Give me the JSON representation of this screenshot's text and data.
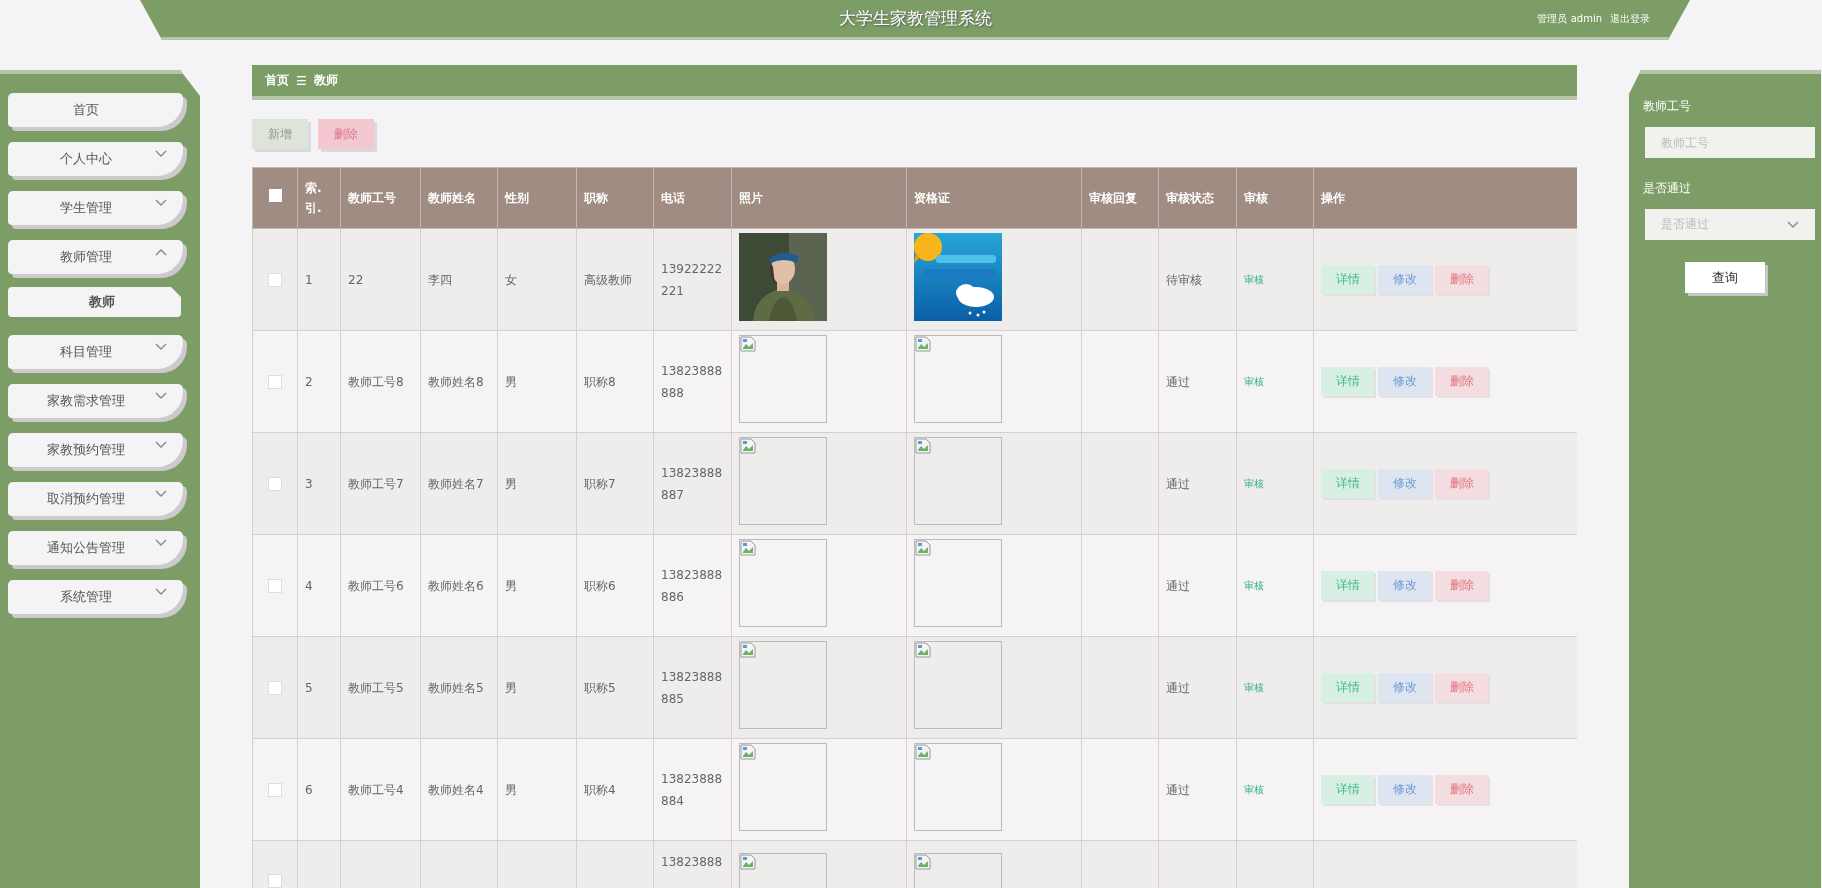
{
  "header": {
    "title": "大学生家教管理系统",
    "user": "管理员 admin",
    "logout": "退出登录"
  },
  "sidebar": {
    "items": [
      {
        "label": "首页",
        "kind": "link"
      },
      {
        "label": "个人中心",
        "kind": "menu",
        "expanded": false
      },
      {
        "label": "学生管理",
        "kind": "menu",
        "expanded": false
      },
      {
        "label": "教师管理",
        "kind": "menu",
        "expanded": true,
        "children": [
          {
            "label": "教师",
            "selected": true
          }
        ]
      },
      {
        "label": "科目管理",
        "kind": "menu",
        "expanded": false
      },
      {
        "label": "家教需求管理",
        "kind": "menu",
        "expanded": false
      },
      {
        "label": "家教预约管理",
        "kind": "menu",
        "expanded": false
      },
      {
        "label": "取消预约管理",
        "kind": "menu",
        "expanded": false
      },
      {
        "label": "通知公告管理",
        "kind": "menu",
        "expanded": false
      },
      {
        "label": "系统管理",
        "kind": "menu",
        "expanded": false
      }
    ]
  },
  "breadcrumb": {
    "home": "首页",
    "separator": "☰",
    "current": "教师"
  },
  "toolbar": [
    {
      "label": "新增",
      "kind": "add"
    },
    {
      "label": "删除",
      "kind": "delete"
    }
  ],
  "table": {
    "select_all": {
      "checked": false
    },
    "columns": [
      "索.引.",
      "教师工号",
      "教师姓名",
      "性别",
      "职称",
      "电话",
      "照片",
      "资格证",
      "审核回复",
      "审核状态",
      "审核",
      "操作"
    ],
    "rows": [
      {
        "checked": false,
        "index": "1",
        "teacher_no": "22",
        "name": "李四",
        "gender": "女",
        "title": "高级教师",
        "phone": "13922222221",
        "status": "待审核",
        "review": "审核",
        "actions": [
          {
            "label": "详情",
            "kind": "detail"
          },
          {
            "label": "修改",
            "kind": "edit"
          },
          {
            "label": "删除",
            "kind": "delete"
          }
        ]
      },
      {
        "checked": false,
        "index": "2",
        "teacher_no": "教师工号8",
        "name": "教师姓名8",
        "gender": "男",
        "title": "职称8",
        "phone": "13823888888",
        "photo": {
          "kind": "broken"
        },
        "certificate": {
          "kind": "broken"
        },
        "status": "通过",
        "review": "审核",
        "actions": [
          {
            "label": "详情",
            "kind": "detail"
          },
          {
            "label": "修改",
            "kind": "edit"
          },
          {
            "label": "删除",
            "kind": "delete"
          }
        ]
      },
      {
        "checked": false,
        "index": "3",
        "teacher_no": "教师工号7",
        "name": "教师姓名7",
        "gender": "男",
        "title": "职称7",
        "phone": "13823888887",
        "photo": {
          "kind": "broken"
        },
        "certificate": {
          "kind": "broken"
        },
        "status": "通过",
        "review": "审核",
        "actions": [
          {
            "label": "详情",
            "kind": "detail"
          },
          {
            "label": "修改",
            "kind": "edit"
          },
          {
            "label": "删除",
            "kind": "delete"
          }
        ]
      },
      {
        "checked": false,
        "index": "4",
        "teacher_no": "教师工号6",
        "name": "教师姓名6",
        "gender": "男",
        "title": "职称6",
        "phone": "13823888886",
        "photo": {
          "kind": "broken"
        },
        "certificate": {
          "kind": "broken"
        },
        "status": "通过",
        "review": "审核",
        "actions": [
          {
            "label": "详情",
            "kind": "detail"
          },
          {
            "label": "修改",
            "kind": "edit"
          },
          {
            "label": "删除",
            "kind": "delete"
          }
        ]
      },
      {
        "checked": false,
        "index": "5",
        "teacher_no": "教师工号5",
        "name": "教师姓名5",
        "gender": "男",
        "title": "职称5",
        "phone": "13823888885",
        "photo": {
          "kind": "broken"
        },
        "certificate": {
          "kind": "broken"
        },
        "status": "通过",
        "review": "审核",
        "actions": [
          {
            "label": "详情",
            "kind": "detail"
          },
          {
            "label": "修改",
            "kind": "edit"
          },
          {
            "label": "删除",
            "kind": "delete"
          }
        ]
      },
      {
        "checked": false,
        "index": "6",
        "teacher_no": "教师工号4",
        "name": "教师姓名4",
        "gender": "男",
        "title": "职称4",
        "phone": "13823888884",
        "photo": {
          "kind": "broken"
        },
        "certificate": {
          "kind": "broken"
        },
        "status": "通过",
        "review": "审核",
        "actions": [
          {
            "label": "详情",
            "kind": "detail"
          },
          {
            "label": "修改",
            "kind": "edit"
          },
          {
            "label": "删除",
            "kind": "delete"
          }
        ]
      },
      {
        "checked": false,
        "phone": "13823888",
        "photo": {
          "kind": "broken"
        },
        "certificate": {
          "kind": "broken"
        }
      }
    ]
  },
  "search": {
    "fields": [
      {
        "label": "教师工号",
        "kind": "input",
        "placeholder": "教师工号"
      },
      {
        "label": "是否通过",
        "kind": "select",
        "placeholder": "是否通过"
      }
    ],
    "button": "查询"
  }
}
